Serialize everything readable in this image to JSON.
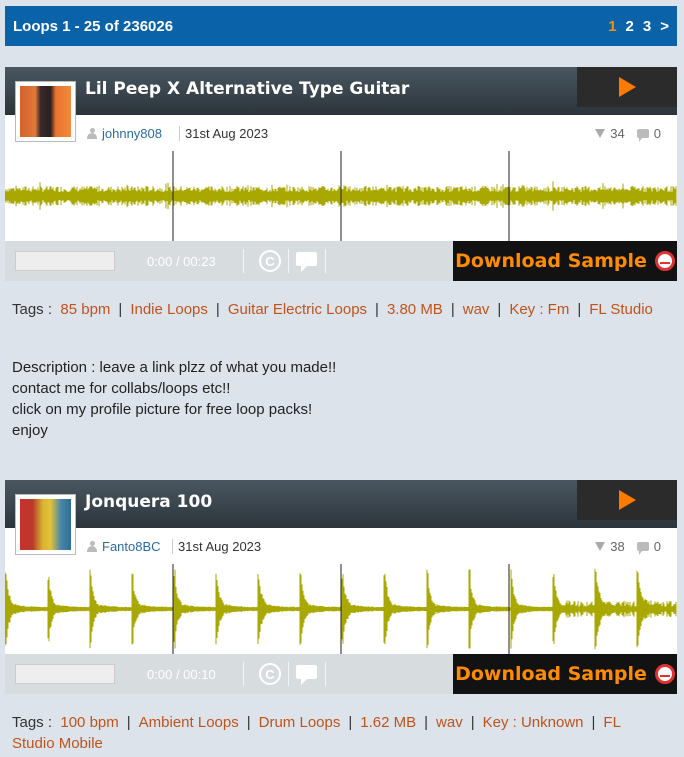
{
  "header": {
    "title": "Loops 1 - 25 of 236026",
    "pages": [
      "1",
      "2",
      "3",
      ">"
    ]
  },
  "loops": [
    {
      "title": "Lil Peep X Alternative Type Guitar",
      "user": "johnny808",
      "date": "31st Aug 2023",
      "downloads": "34",
      "comments": "0",
      "time_current": "0:00",
      "time_total": "/ 00:23",
      "download_label": "Download Sample",
      "tags_label": "Tags :",
      "tags": [
        "85 bpm",
        "Indie Loops",
        "Guitar Electric Loops",
        "3.80 MB",
        "wav",
        "Key : Fm",
        "FL Studio"
      ],
      "description": [
        "Description : leave a link plzz of what you made!!",
        "contact me for collabs/loops etc!!",
        "click on my profile picture for free loop packs!",
        "enjoy"
      ]
    },
    {
      "title": "Jonquera 100",
      "user": "Fanto8BC",
      "date": "31st Aug 2023",
      "downloads": "38",
      "comments": "0",
      "time_current": "0:00",
      "time_total": "/ 00:10",
      "download_label": "Download Sample",
      "tags_label": "Tags :",
      "tags": [
        "100 bpm",
        "Ambient Loops",
        "Drum Loops",
        "1.62 MB",
        "wav",
        "Key : Unknown",
        "FL Studio Mobile"
      ],
      "description": []
    }
  ],
  "colors": {
    "header_bg": "#0a63a8",
    "accent": "#ff8c00",
    "waveform": "#a8a800",
    "tag_link": "#c0531c"
  },
  "icons": {
    "play": "play-icon",
    "user": "user-icon",
    "downloads": "download-count-icon",
    "comments": "comment-icon",
    "copyright": "copyright-icon",
    "chat": "chat-icon",
    "drum": "drum-icon"
  }
}
